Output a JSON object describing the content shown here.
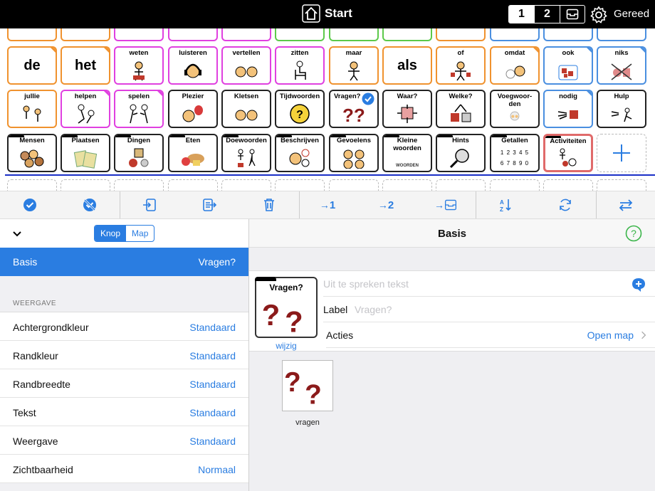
{
  "topbar": {
    "title": "Start",
    "pages": [
      "1",
      "2"
    ],
    "active_page": "1",
    "done_label": "Gereed"
  },
  "grid": {
    "row1": [
      "de",
      "het",
      "weten",
      "luisteren",
      "vertellen",
      "zitten",
      "maar",
      "als",
      "of",
      "omdat",
      "ook",
      "niks"
    ],
    "row2": [
      "jullie",
      "helpen",
      "spelen",
      "Plezier",
      "Kletsen",
      "Tijdwoorden",
      "Vragen?",
      "Waar?",
      "Welke?",
      "Voegwoor-\nden",
      "nodig",
      "Hulp"
    ],
    "row3": [
      "Mensen",
      "Plaatsen",
      "Dingen",
      "Eten",
      "Doewoorden",
      "Beschrijven",
      "Gevoelens",
      "Kleine\nwoorden",
      "Hints",
      "Getallen",
      "Activiteiten"
    ],
    "getallen_digits1": "1 2 3 4 5",
    "getallen_digits2": "6 7 8 9 0",
    "kleine_woorden_pic": "WOORDEN"
  },
  "toolbar": {
    "move1": "1",
    "move2": "2"
  },
  "left": {
    "modes": [
      "Knop",
      "Map"
    ],
    "active_mode": "Knop",
    "selected": {
      "label": "Basis",
      "value": "Vragen?"
    },
    "section": "WEERGAVE",
    "props": [
      {
        "key": "Achtergrondkleur",
        "value": "Standaard"
      },
      {
        "key": "Randkleur",
        "value": "Standaard"
      },
      {
        "key": "Randbreedte",
        "value": "Standaard"
      },
      {
        "key": "Tekst",
        "value": "Standaard"
      },
      {
        "key": "Weergave",
        "value": "Standaard"
      },
      {
        "key": "Zichtbaarheid",
        "value": "Normaal"
      }
    ]
  },
  "right": {
    "title": "Basis",
    "preview_label": "Vragen?",
    "edit_label": "wijzig",
    "speak_placeholder": "Uit te spreken tekst",
    "label_key": "Label",
    "label_placeholder": "Vragen?",
    "actions_key": "Acties",
    "actions_value": "Open map",
    "image_caption": "vragen"
  },
  "colors": {
    "accent": "#2a7de1",
    "orange": "#f0922e",
    "pink": "#e040e0",
    "green": "#5cc94a",
    "blue": "#4a8fe0",
    "red": "#e06a6a"
  }
}
